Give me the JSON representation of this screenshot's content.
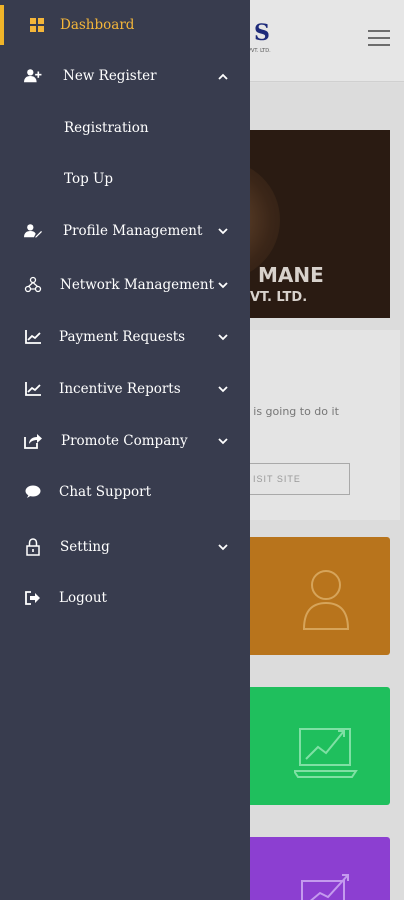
{
  "background": {
    "logo_text": "S",
    "logo_sub": "PVT. LTD.",
    "banner_line1": "MANE",
    "banner_line2": "VT. LTD.",
    "partial_text": "e is going to do it",
    "visit_button": "ISIT SITE"
  },
  "drawer": {
    "items": [
      {
        "label": "Dashboard",
        "icon": "dashboard-grid-icon"
      },
      {
        "label": "New Register",
        "icon": "user-plus-icon",
        "chevron": "up"
      },
      {
        "label": "Registration"
      },
      {
        "label": "Top Up"
      },
      {
        "label": "Profile Management",
        "icon": "user-edit-icon",
        "chevron": "down"
      },
      {
        "label": "Network Management",
        "icon": "network-icon",
        "chevron": "down"
      },
      {
        "label": "Payment Requests",
        "icon": "chart-icon",
        "chevron": "down"
      },
      {
        "label": "Incentive Reports",
        "icon": "chart-icon",
        "chevron": "down"
      },
      {
        "label": "Promote Company",
        "icon": "share-icon",
        "chevron": "down"
      },
      {
        "label": "Chat Support",
        "icon": "chat-bubble-icon"
      },
      {
        "label": "Setting",
        "icon": "lock-icon",
        "chevron": "down"
      },
      {
        "label": "Logout",
        "icon": "logout-icon"
      }
    ]
  },
  "colors": {
    "drawer_bg": "#383c4e",
    "active": "#f4b63a",
    "orange_tile": "#b8741c",
    "green_tile": "#1fbf5d",
    "purple_tile": "#8c3fd1"
  }
}
